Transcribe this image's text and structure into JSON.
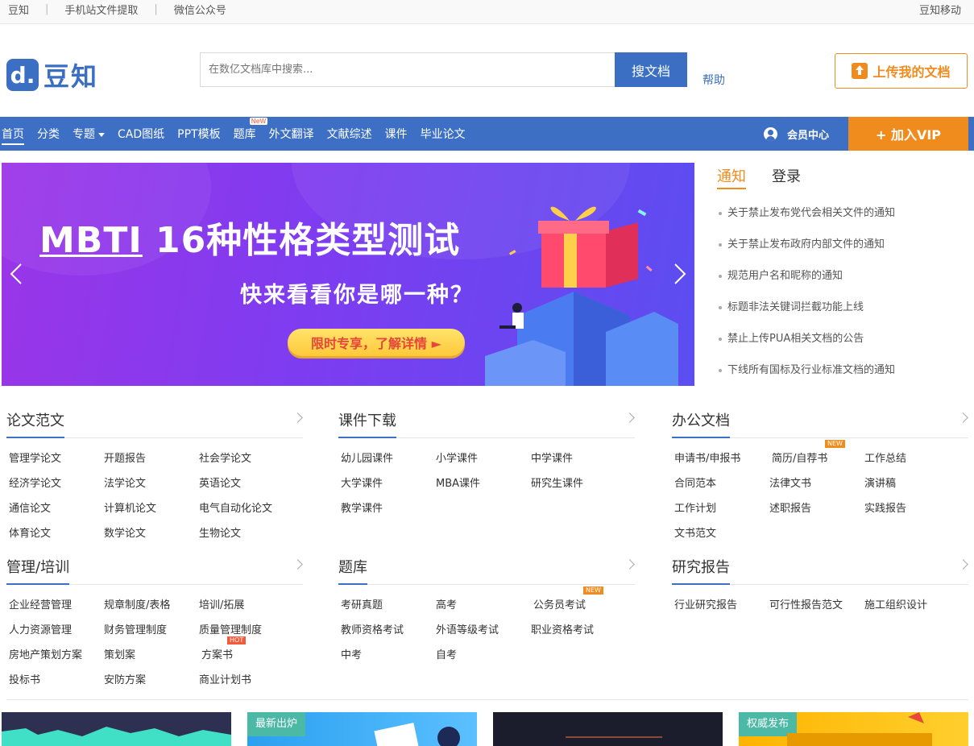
{
  "topbar": {
    "links": [
      "豆知",
      "手机站文件提取",
      "微信公众号"
    ],
    "separator": "|",
    "right": "豆知移动"
  },
  "header": {
    "logo_mark": "d.",
    "logo_text": "豆知",
    "search_placeholder": "在数亿文档库中搜索...",
    "search_button": "搜文档",
    "help": "帮助",
    "upload": "上传我的文档"
  },
  "nav": {
    "items": [
      "首页",
      "分类",
      "专题",
      "CAD图纸",
      "PPT模板",
      "题库",
      "外文翻译",
      "文献综述",
      "课件",
      "毕业论文"
    ],
    "new_tag": "NeW",
    "member": "会员中心",
    "vip": "+ 加入VIP"
  },
  "banner": {
    "title": "MBTI 16种性格类型测试",
    "subtitle": "快来看看你是哪一种？",
    "cta": "限时专享，了解详情 ►"
  },
  "notice": {
    "tabs": [
      "通知",
      "登录"
    ],
    "items": [
      "关于禁止发布党代会相关文件的通知",
      "关于禁止发布政府内部文件的通知",
      "规范用户名和昵称的通知",
      "标题非法关键词拦截功能上线",
      "禁止上传PUA相关文档的公告",
      "下线所有国标及行业标准文档的通知"
    ]
  },
  "categories": [
    {
      "name": "论文范文",
      "items": [
        "管理学论文",
        "开题报告",
        "社会学论文",
        "经济学论文",
        "法学论文",
        "英语论文",
        "通信论文",
        "计算机论文",
        "电气自动化论文",
        "体育论文",
        "数学论文",
        "生物论文"
      ]
    },
    {
      "name": "课件下载",
      "items": [
        "幼儿园课件",
        "小学课件",
        "中学课件",
        "大学课件",
        "MBA课件",
        "研究生课件",
        "教学课件"
      ]
    },
    {
      "name": "办公文档",
      "items": [
        "申请书/申报书",
        "简历/自荐书",
        "工作总结",
        "合同范本",
        "法律文书",
        "演讲稿",
        "工作计划",
        "述职报告",
        "实践报告",
        "文书范文"
      ],
      "tag_text": "NEW"
    },
    {
      "name": "管理/培训",
      "items": [
        "企业经营管理",
        "规章制度/表格",
        "培训/拓展",
        "人力资源管理",
        "财务管理制度",
        "质量管理制度",
        "房地产策划方案",
        "策划案",
        "方案书",
        "投标书",
        "安防方案",
        "商业计划书"
      ],
      "tag_text": "HOT"
    },
    {
      "name": "题库",
      "items": [
        "考研真题",
        "高考",
        "公务员考试",
        "教师资格考试",
        "外语等级考试",
        "职业资格考试",
        "中考",
        "自考"
      ],
      "tag_text": "NEW"
    },
    {
      "name": "研究报告",
      "items": [
        "行业研究报告",
        "可行性报告范文",
        "施工组织设计"
      ]
    }
  ],
  "promos": [
    {
      "badge": ""
    },
    {
      "badge": "最新出炉"
    },
    {
      "badge": ""
    },
    {
      "badge": "权威发布"
    }
  ],
  "colors": {
    "brand": "#3d6fc5",
    "accent": "#f08c1d",
    "banner": "#7e3cf0"
  }
}
